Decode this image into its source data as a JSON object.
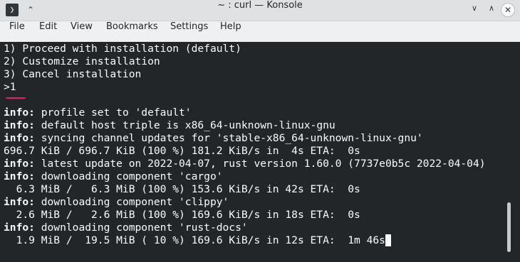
{
  "window": {
    "title": "~ : curl — Konsole",
    "app_icon_glyph": "❯",
    "keep_above_glyph": "⌃",
    "minimize_glyph": "∨",
    "maximize_glyph": "∧",
    "close_glyph": "✕"
  },
  "menubar": {
    "file": "File",
    "edit": "Edit",
    "view": "View",
    "bookmarks": "Bookmarks",
    "settings": "Settings",
    "help": "Help"
  },
  "terminal": {
    "lines": [
      {
        "prefix": "",
        "text": "1) Proceed with installation (default)"
      },
      {
        "prefix": "",
        "text": "2) Customize installation"
      },
      {
        "prefix": "",
        "text": "3) Cancel installation"
      },
      {
        "prefix": "",
        "text": ">1"
      },
      {
        "prefix": "",
        "text": ""
      },
      {
        "prefix": "info:",
        "text": " profile set to 'default'"
      },
      {
        "prefix": "info:",
        "text": " default host triple is x86_64-unknown-linux-gnu"
      },
      {
        "prefix": "info:",
        "text": " syncing channel updates for 'stable-x86_64-unknown-linux-gnu'"
      },
      {
        "prefix": "",
        "text": "696.7 KiB / 696.7 KiB (100 %) 181.2 KiB/s in  4s ETA:  0s"
      },
      {
        "prefix": "info:",
        "text": " latest update on 2022-04-07, rust version 1.60.0 (7737e0b5c 2022-04-04)"
      },
      {
        "prefix": "info:",
        "text": " downloading component 'cargo'"
      },
      {
        "prefix": "",
        "text": "  6.3 MiB /   6.3 MiB (100 %) 153.6 KiB/s in 42s ETA:  0s"
      },
      {
        "prefix": "info:",
        "text": " downloading component 'clippy'"
      },
      {
        "prefix": "",
        "text": "  2.6 MiB /   2.6 MiB (100 %) 169.6 KiB/s in 18s ETA:  0s"
      },
      {
        "prefix": "info:",
        "text": " downloading component 'rust-docs'"
      },
      {
        "prefix": "",
        "text": "  1.9 MiB /  19.5 MiB ( 10 %) 169.6 KiB/s in 12s ETA:  1m 46s"
      }
    ]
  },
  "colors": {
    "terminal_bg": "#232629",
    "terminal_fg": "#fcfcfc",
    "accent": "#e0245e"
  }
}
